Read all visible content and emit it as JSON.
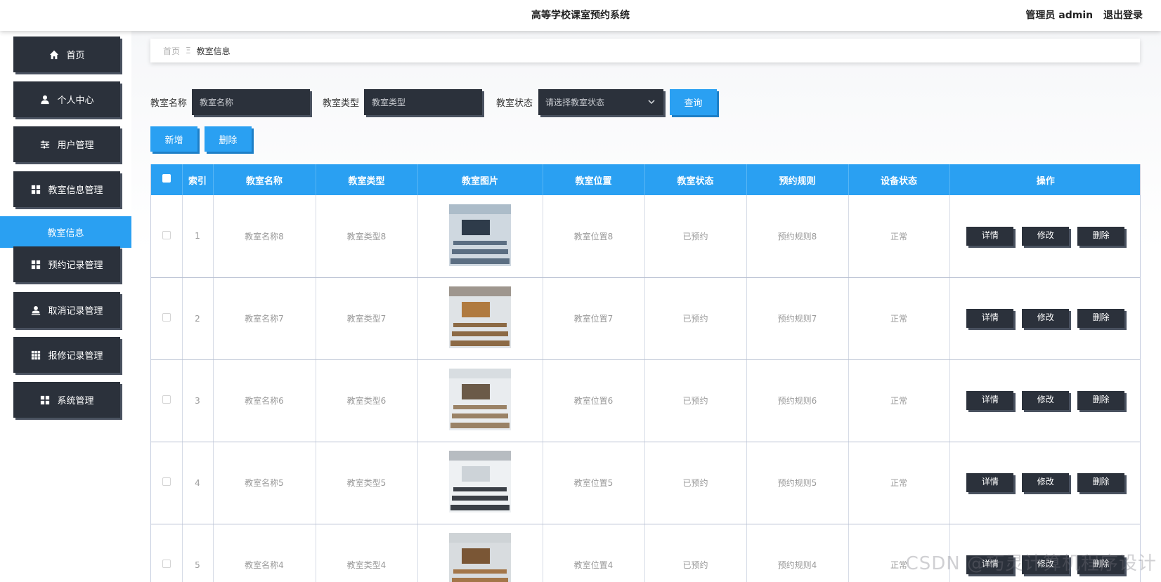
{
  "header": {
    "title": "高等学校课室预约系统",
    "role": "管理员 admin",
    "logout": "退出登录"
  },
  "sidebar": {
    "items": [
      {
        "label": "首页",
        "icon": "home-icon"
      },
      {
        "label": "个人中心",
        "icon": "user-icon"
      },
      {
        "label": "用户管理",
        "icon": "sliders-icon"
      },
      {
        "label": "教室信息管理",
        "icon": "grid-icon"
      },
      {
        "label": "预约记录管理",
        "icon": "grid-icon"
      },
      {
        "label": "取消记录管理",
        "icon": "user-card-icon"
      },
      {
        "label": "报修记录管理",
        "icon": "apps-icon"
      },
      {
        "label": "系统管理",
        "icon": "grid-icon"
      }
    ],
    "active_sub": "教室信息"
  },
  "breadcrumb": {
    "home": "首页",
    "current": "教室信息"
  },
  "search": {
    "name_label": "教室名称",
    "name_placeholder": "教室名称",
    "type_label": "教室类型",
    "type_placeholder": "教室类型",
    "status_label": "教室状态",
    "status_placeholder": "请选择教室状态",
    "query_button": "查询"
  },
  "actions": {
    "add": "新增",
    "delete": "删除"
  },
  "table": {
    "headers": [
      "",
      "索引",
      "教室名称",
      "教室类型",
      "教室图片",
      "教室位置",
      "教室状态",
      "预约规则",
      "设备状态",
      "操作"
    ],
    "ops": [
      "详情",
      "修改",
      "删除"
    ],
    "rows": [
      {
        "index": "1",
        "name": "教室名称8",
        "type": "教室类型8",
        "location": "教室位置8",
        "status": "已预约",
        "rule": "预约规则8",
        "device": "正常"
      },
      {
        "index": "2",
        "name": "教室名称7",
        "type": "教室类型7",
        "location": "教室位置7",
        "status": "已预约",
        "rule": "预约规则7",
        "device": "正常"
      },
      {
        "index": "3",
        "name": "教室名称6",
        "type": "教室类型6",
        "location": "教室位置6",
        "status": "已预约",
        "rule": "预约规则6",
        "device": "正常"
      },
      {
        "index": "4",
        "name": "教室名称5",
        "type": "教室类型5",
        "location": "教室位置5",
        "status": "已预约",
        "rule": "预约规则5",
        "device": "正常"
      },
      {
        "index": "5",
        "name": "教室名称4",
        "type": "教室类型4",
        "location": "教室位置4",
        "status": "已预约",
        "rule": "预约规则4",
        "device": "正常"
      }
    ]
  },
  "watermark": "CSDN @巧灵计算机程序设计",
  "colors": {
    "accent": "#2aa0f2",
    "dark": "#2b313b"
  }
}
